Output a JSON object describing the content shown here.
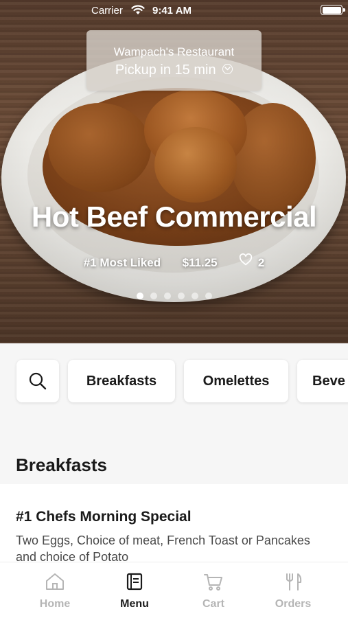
{
  "status_bar": {
    "carrier": "Carrier",
    "time": "9:41 AM"
  },
  "pickup": {
    "restaurant": "Wampach's Restaurant",
    "time_label": "Pickup in 15 min"
  },
  "hero": {
    "dish_title": "Hot Beef Commercial",
    "badge": "#1 Most Liked",
    "price": "$11.25",
    "likes": "2",
    "slides": 6,
    "active_slide": 1
  },
  "categories": {
    "items": [
      "Breakfasts",
      "Omelettes",
      "Beve"
    ]
  },
  "section": {
    "title": "Breakfasts",
    "items": [
      {
        "name": "#1 Chefs Morning Special",
        "description": "Two Eggs, Choice of meat, French Toast or Pancakes and choice of Potato"
      }
    ]
  },
  "tab_bar": {
    "items": [
      {
        "label": "Home",
        "icon": "home-icon"
      },
      {
        "label": "Menu",
        "icon": "menu-icon"
      },
      {
        "label": "Cart",
        "icon": "cart-icon"
      },
      {
        "label": "Orders",
        "icon": "orders-icon"
      }
    ],
    "active": "Menu"
  },
  "colors": {
    "text_primary": "#1a1a1a",
    "tab_inactive": "#b5b5b5",
    "background": "#f6f6f6"
  }
}
